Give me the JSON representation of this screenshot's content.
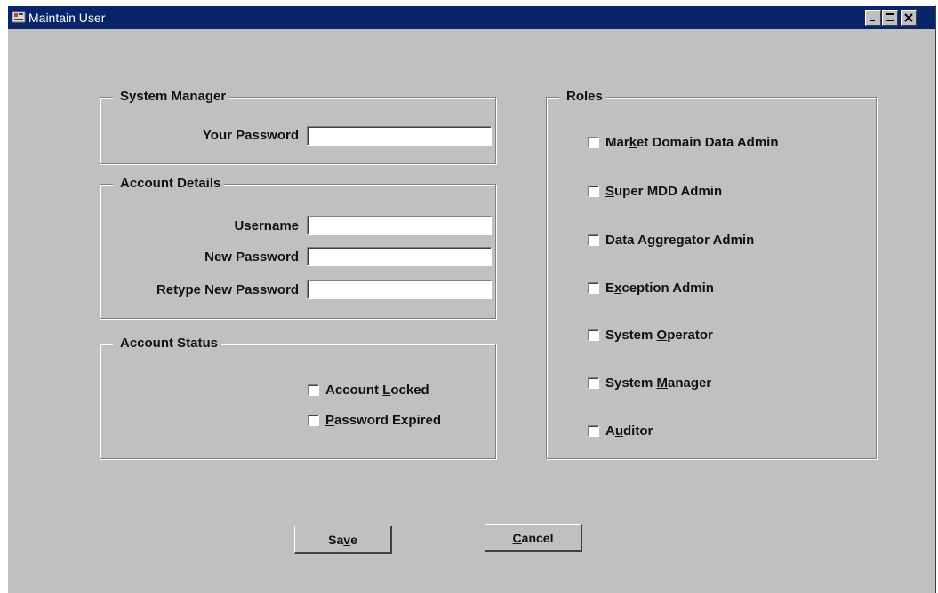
{
  "window": {
    "title": "Maintain User"
  },
  "system_manager": {
    "label": "System Manager",
    "your_password_label": "Your Password",
    "your_password_value": ""
  },
  "account_details": {
    "label": "Account Details",
    "username_label": "Username",
    "username_value": "",
    "new_password_label": "New Password",
    "new_password_value": "",
    "retype_password_label": "Retype New Password",
    "retype_password_value": ""
  },
  "account_status": {
    "label": "Account Status",
    "items": [
      {
        "pre": "Account ",
        "mnemonic": "L",
        "post": "ocked",
        "checked": false
      },
      {
        "pre": "",
        "mnemonic": "P",
        "post": "assword Expired",
        "checked": false
      }
    ]
  },
  "roles": {
    "label": "Roles",
    "items": [
      {
        "pre": "Mar",
        "mnemonic": "k",
        "post": "et Domain Data Admin",
        "checked": false
      },
      {
        "pre": "",
        "mnemonic": "S",
        "post": "uper MDD Admin",
        "checked": false
      },
      {
        "pre": "Data Aggregator Admin",
        "mnemonic": "",
        "post": "",
        "checked": false
      },
      {
        "pre": "E",
        "mnemonic": "x",
        "post": "ception Admin",
        "checked": false
      },
      {
        "pre": "System ",
        "mnemonic": "O",
        "post": "perator",
        "checked": false
      },
      {
        "pre": "System ",
        "mnemonic": "M",
        "post": "anager",
        "checked": false
      },
      {
        "pre": "A",
        "mnemonic": "u",
        "post": "ditor",
        "checked": false
      }
    ]
  },
  "buttons": {
    "save": {
      "pre": "Sa",
      "mnemonic": "v",
      "post": "e"
    },
    "cancel": {
      "pre": "",
      "mnemonic": "C",
      "post": "ancel"
    }
  },
  "colors": {
    "titlebar": "#0a246a",
    "face": "#c0c0c0"
  }
}
